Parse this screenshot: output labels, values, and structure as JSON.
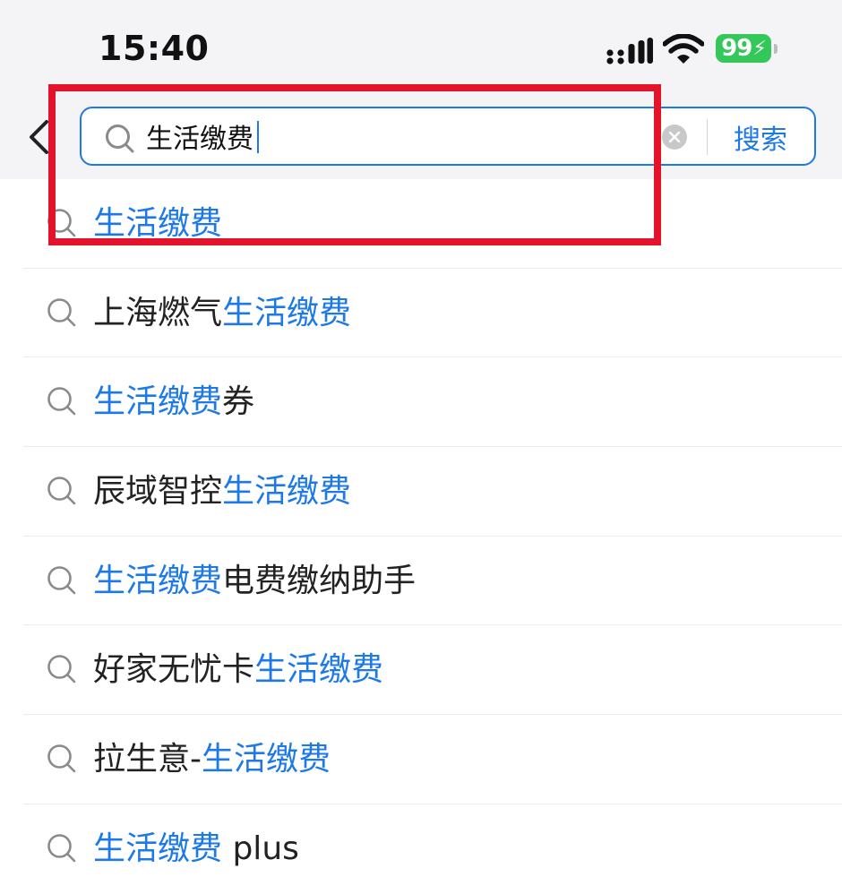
{
  "status_bar": {
    "time": "15:40",
    "battery": "99"
  },
  "search": {
    "query": "生活缴费",
    "button_label": "搜索"
  },
  "suggestions": [
    {
      "parts": [
        {
          "text": "生活缴费",
          "hl": true
        }
      ]
    },
    {
      "parts": [
        {
          "text": "上海燃气",
          "hl": false
        },
        {
          "text": "生活缴费",
          "hl": true
        }
      ]
    },
    {
      "parts": [
        {
          "text": "生活缴费",
          "hl": true
        },
        {
          "text": "券",
          "hl": false
        }
      ]
    },
    {
      "parts": [
        {
          "text": "辰域智控",
          "hl": false
        },
        {
          "text": "生活缴费",
          "hl": true
        }
      ]
    },
    {
      "parts": [
        {
          "text": "生活缴费",
          "hl": true
        },
        {
          "text": "电费缴纳助手",
          "hl": false
        }
      ]
    },
    {
      "parts": [
        {
          "text": "好家无忧卡",
          "hl": false
        },
        {
          "text": "生活缴费",
          "hl": true
        }
      ]
    },
    {
      "parts": [
        {
          "text": "拉生意-",
          "hl": false
        },
        {
          "text": "生活缴费",
          "hl": true
        }
      ]
    },
    {
      "parts": [
        {
          "text": "生活缴费",
          "hl": true
        },
        {
          "text": " plus",
          "hl": false
        }
      ]
    }
  ],
  "colors": {
    "accent": "#1d79e8",
    "annotation": "#e4132c",
    "battery": "#34c759"
  },
  "icons": {
    "back": "chevron-left-icon",
    "search": "magnifier-icon",
    "clear": "clear-circle-icon"
  }
}
